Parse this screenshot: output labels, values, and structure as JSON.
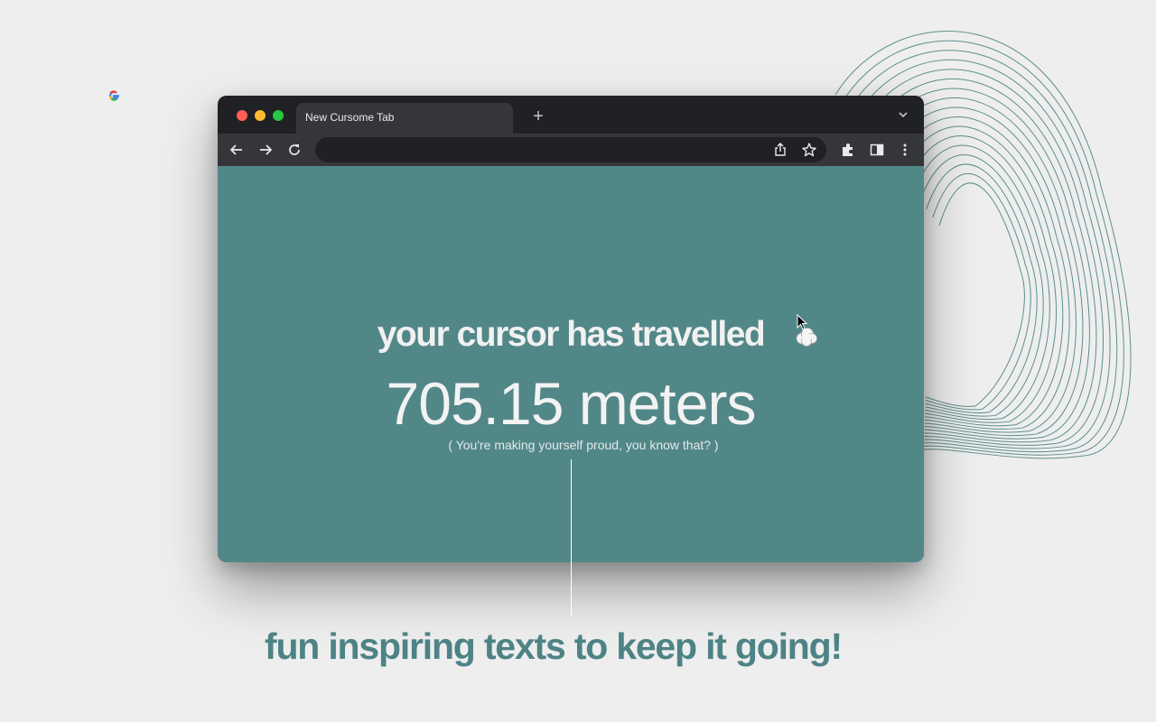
{
  "browser": {
    "tab_title": "New Cursome Tab",
    "new_tab_symbol": "+",
    "icons": [
      "google-favicon",
      "chevron-down-icon",
      "back-arrow-icon",
      "forward-arrow-icon",
      "reload-icon",
      "share-icon",
      "star-icon",
      "extensions-icon",
      "side-panel-icon",
      "more-vert-icon"
    ]
  },
  "page": {
    "headline": "your cursor has travelled",
    "headline_emoji": "cloud-icon",
    "distance": "705.15 meters",
    "encouragement": "( You're making yourself proud, you know that? )",
    "background_color": "#528788"
  },
  "caption": {
    "text": "fun inspiring texts to keep it going!",
    "color": "#4d8385"
  }
}
